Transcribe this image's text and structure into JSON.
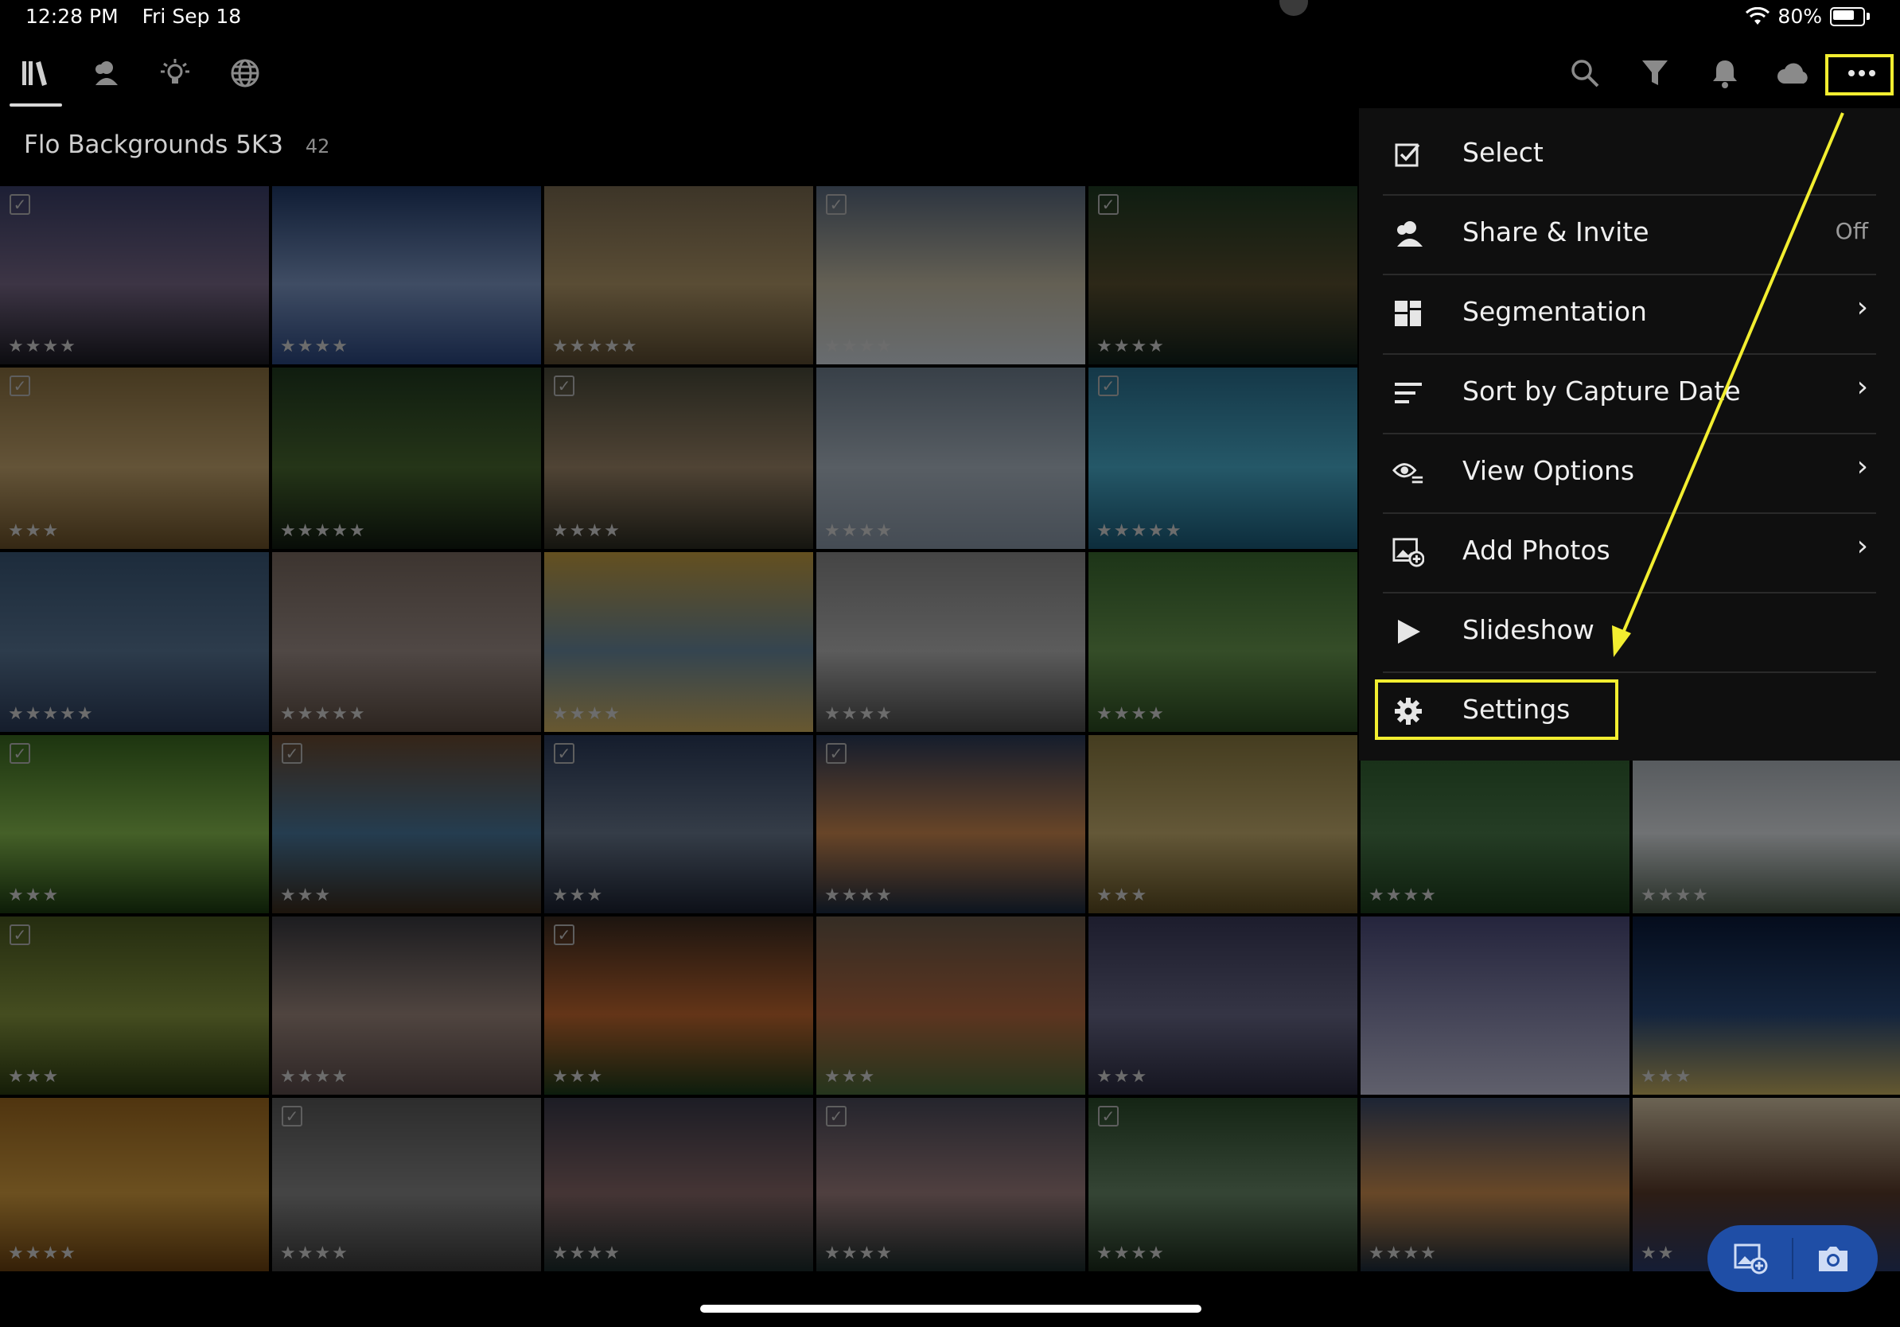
{
  "status_bar": {
    "time": "12:28 PM",
    "date": "Fri Sep 18",
    "battery": "80%"
  },
  "toolbar": {
    "left_icons": [
      "library-icon",
      "people-icon",
      "learn-icon",
      "discover-icon"
    ],
    "right_icons": [
      "search-icon",
      "filter-icon",
      "notifications-icon",
      "cloud-icon",
      "more-icon"
    ]
  },
  "album": {
    "title": "Flo Backgrounds 5K3",
    "count": "42"
  },
  "menu": {
    "items": [
      {
        "label": "Select",
        "icon": "select-icon",
        "right": ""
      },
      {
        "label": "Share & Invite",
        "icon": "share-icon",
        "right": "Off"
      },
      {
        "label": "Segmentation",
        "icon": "segmentation-icon",
        "right": "›"
      },
      {
        "label": "Sort by Capture Date",
        "icon": "sort-icon",
        "right": "›"
      },
      {
        "label": "View Options",
        "icon": "view-options-icon",
        "right": "›"
      },
      {
        "label": "Add Photos",
        "icon": "add-photos-icon",
        "right": "›"
      },
      {
        "label": "Slideshow",
        "icon": "slideshow-icon",
        "right": ""
      },
      {
        "label": "Settings",
        "icon": "settings-icon",
        "right": ""
      }
    ]
  },
  "photos": [
    {
      "stars": "★★★★",
      "checked": true
    },
    {
      "stars": "★★★★",
      "checked": false
    },
    {
      "stars": "★★★★★",
      "checked": false
    },
    {
      "stars": "★★★★",
      "checked": true
    },
    {
      "stars": "★★★★",
      "checked": true
    },
    {
      "stars": "★★★",
      "checked": true
    },
    {
      "stars": "★★★★★",
      "checked": false
    },
    {
      "stars": "★★★★",
      "checked": true
    },
    {
      "stars": "★★★★",
      "checked": false
    },
    {
      "stars": "★★★★★",
      "checked": true
    },
    {
      "stars": "★★★★★",
      "checked": false
    },
    {
      "stars": "★★★★★",
      "checked": false
    },
    {
      "stars": "★★★★",
      "checked": false
    },
    {
      "stars": "★★★★",
      "checked": false
    },
    {
      "stars": "★★★★",
      "checked": false
    },
    {
      "stars": "★★★",
      "checked": true
    },
    {
      "stars": "★★★",
      "checked": true
    },
    {
      "stars": "★★★",
      "checked": true
    },
    {
      "stars": "★★★★",
      "checked": true
    },
    {
      "stars": "★★★",
      "checked": false
    },
    {
      "stars": "★★★★",
      "checked": false
    },
    {
      "stars": "★★★★",
      "checked": false
    },
    {
      "stars": "★★★",
      "checked": true
    },
    {
      "stars": "★★★★",
      "checked": false
    },
    {
      "stars": "★★★",
      "checked": true
    },
    {
      "stars": "★★★",
      "checked": false
    },
    {
      "stars": "★★★",
      "checked": false
    },
    {
      "stars": "",
      "checked": false
    },
    {
      "stars": "★★★",
      "checked": false
    },
    {
      "stars": "★★★★",
      "checked": false
    },
    {
      "stars": "★★★★",
      "checked": true
    },
    {
      "stars": "★★★★",
      "checked": false
    },
    {
      "stars": "★★★★",
      "checked": true
    },
    {
      "stars": "★★★★",
      "checked": true
    },
    {
      "stars": "★★★★",
      "checked": false
    },
    {
      "stars": "★★",
      "checked": false
    }
  ],
  "fab": {
    "icons": [
      "import-photo-icon",
      "camera-icon"
    ]
  }
}
